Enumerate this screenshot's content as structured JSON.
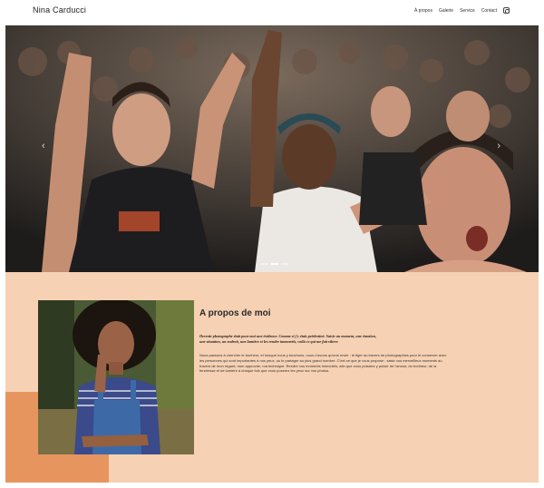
{
  "header": {
    "brand": "Nina Carducci",
    "nav": [
      {
        "label": "À propos"
      },
      {
        "label": "Galerie"
      },
      {
        "label": "Service"
      },
      {
        "label": "Contact"
      }
    ],
    "instagram_icon": "instagram-icon"
  },
  "hero": {
    "prev_icon": "‹",
    "next_icon": "›",
    "slides": 3,
    "active_slide": 1
  },
  "about": {
    "title": "A propos de moi",
    "quote": "Devenir photographe était pour moi une évidence. Comme si j'y étais prédestiné. Saisir un moment, une émotion, une situation, un endroit, une lumière et les rendre immortels, voilà ce qui me fait vibrer.",
    "body": "Nous passons à chercher le bonheur, et lorsque nous y touchons, nous n'avons qu'une envie : le figer au travers de photographies pour le conserver avec les personnes qui sont importantes à nos yeux, ou le partager au plus grand nombre. C'est ce que je vous propose : saisir vos merveilleux moments au travers de mon regard, mon approche, ma technique. Rendre vos moments immortels, afin que vous puissiez y puiser de l'amour, du bonheur, de la tendresse et de lumière à chaque fois que vous poserez les yeux sur vos photos."
  },
  "colors": {
    "about_bg": "#f6d1b3",
    "accent": "#e7955f"
  }
}
